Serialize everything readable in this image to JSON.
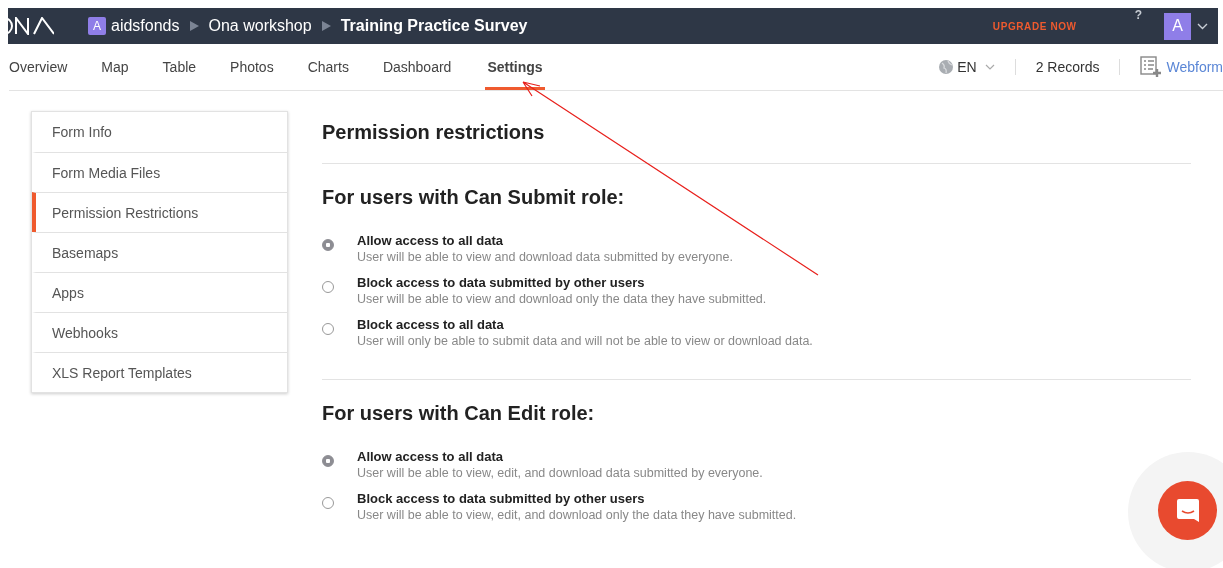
{
  "header": {
    "breadcrumbs": [
      {
        "avatar": "A",
        "label": "aidsfonds",
        "current": false
      },
      {
        "label": "Ona workshop",
        "current": false
      },
      {
        "label": "Training Practice Survey",
        "current": true
      }
    ],
    "upgrade": "UPGRADE NOW",
    "help": "?",
    "user_initial": "A"
  },
  "tabs": [
    {
      "label": "Overview",
      "selected": false
    },
    {
      "label": "Map",
      "selected": false
    },
    {
      "label": "Table",
      "selected": false
    },
    {
      "label": "Photos",
      "selected": false
    },
    {
      "label": "Charts",
      "selected": false
    },
    {
      "label": "Dashboard",
      "selected": false
    },
    {
      "label": "Settings",
      "selected": true
    }
  ],
  "toolbar": {
    "language": "EN",
    "records": "2 Records",
    "webform": "Webform"
  },
  "sidebar": {
    "items": [
      {
        "label": "Form Info",
        "selected": false
      },
      {
        "label": "Form Media Files",
        "selected": false
      },
      {
        "label": "Permission Restrictions",
        "selected": true
      },
      {
        "label": "Basemaps",
        "selected": false
      },
      {
        "label": "Apps",
        "selected": false
      },
      {
        "label": "Webhooks",
        "selected": false
      },
      {
        "label": "XLS Report Templates",
        "selected": false
      }
    ]
  },
  "content": {
    "title": "Permission restrictions",
    "sections": [
      {
        "heading": "For users with Can Submit role:",
        "options": [
          {
            "label": "Allow access to all data",
            "description": "User will be able to view and download data submitted by everyone.",
            "selected": true
          },
          {
            "label": "Block access to data submitted by other users",
            "description": "User will be able to view and download only the data they have submitted.",
            "selected": false
          },
          {
            "label": "Block access to all data",
            "description": "User will only be able to submit data and will not be able to view or download data.",
            "selected": false
          }
        ]
      },
      {
        "heading": "For users with Can Edit role:",
        "options": [
          {
            "label": "Allow access to all data",
            "description": "User will be able to view, edit, and download data submitted by everyone.",
            "selected": true
          },
          {
            "label": "Block access to data submitted by other users",
            "description": "User will be able to view, edit, and download only the data they have submitted.",
            "selected": false
          }
        ]
      }
    ]
  }
}
